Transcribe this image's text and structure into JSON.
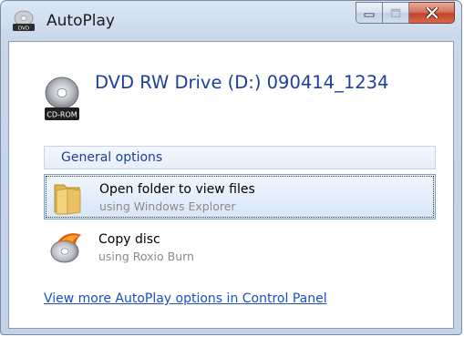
{
  "window": {
    "title": "AutoPlay",
    "icon": "autoplay-dvd-icon"
  },
  "caption_buttons": {
    "minimize_icon": "minimize-icon",
    "maximize_icon": "maximize-icon",
    "close_icon": "close-icon"
  },
  "device": {
    "title": "DVD RW Drive (D:) 090414_1234",
    "icon_label": "CD-ROM",
    "icon": "cd-rom-drive-icon"
  },
  "section": {
    "label": "General options"
  },
  "options": [
    {
      "title": "Open folder to view files",
      "subtitle": "using Windows Explorer",
      "icon": "folder-icon",
      "selected": true
    },
    {
      "title": "Copy disc",
      "subtitle": "using Roxio Burn",
      "icon": "disc-burn-icon",
      "selected": false
    }
  ],
  "link": {
    "label": "View more AutoPlay options in Control Panel"
  },
  "colors": {
    "accent_text": "#1e3f9a",
    "link": "#1a4fc2",
    "close_button": "#c5432a",
    "selection": "#d8e6f7"
  }
}
